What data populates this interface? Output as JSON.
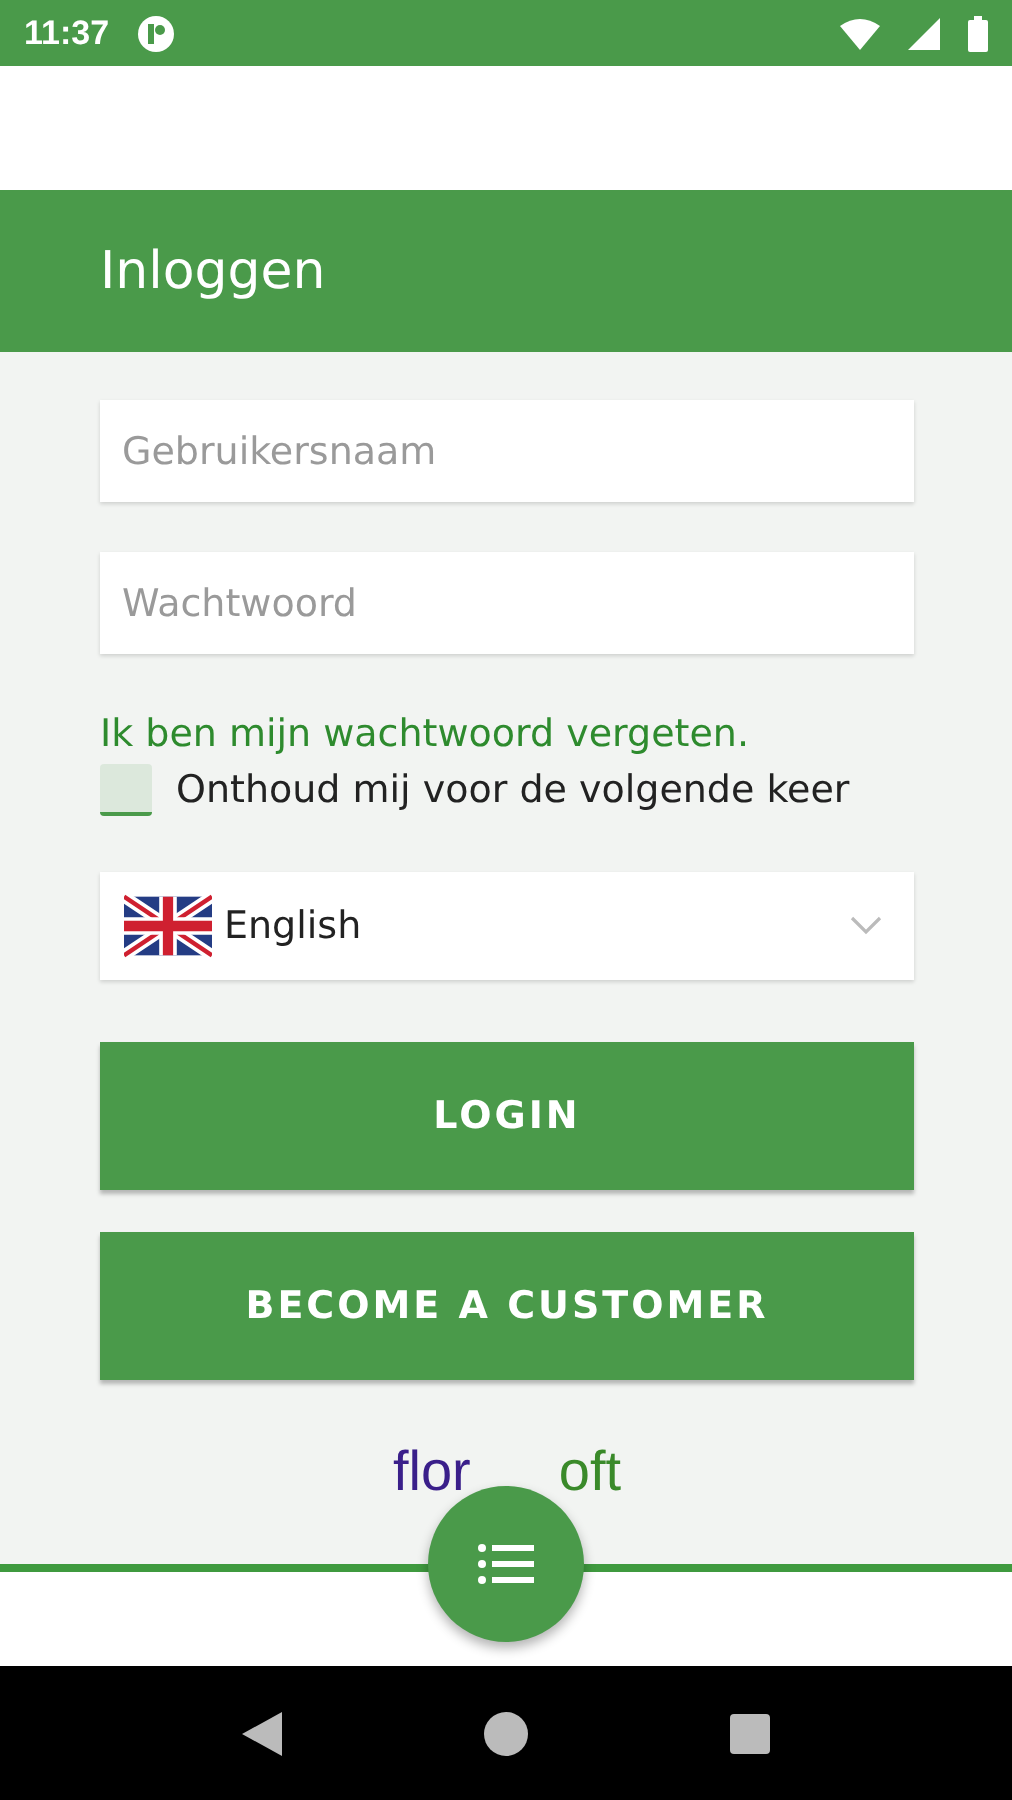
{
  "status_bar": {
    "time": "11:37"
  },
  "header": {
    "title": "Inloggen"
  },
  "form": {
    "username": {
      "placeholder": "Gebruikersnaam"
    },
    "password": {
      "placeholder": "Wachtwoord"
    },
    "forgot_link": "Ik ben mijn wachtwoord vergeten.",
    "remember": {
      "label": "Onthoud mij voor de volgende keer",
      "checked": false
    },
    "language": {
      "value": "English"
    },
    "buttons": [
      "LOGIN",
      "BECOME A CUSTOMER"
    ]
  },
  "logo": {
    "left": "flor",
    "right": "oft"
  }
}
